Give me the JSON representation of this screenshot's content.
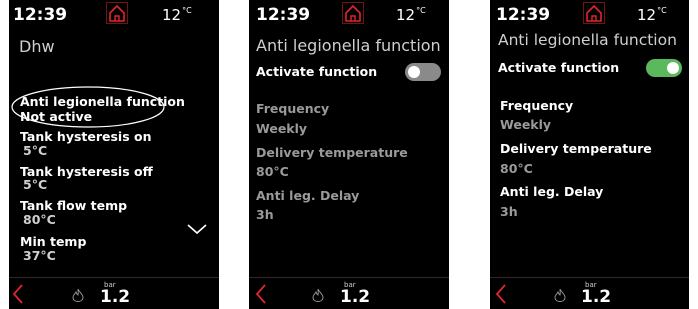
{
  "colors": {
    "accent": "#e0262c",
    "toggle_on": "#5cb85c",
    "toggle_off": "#8a8a8a"
  },
  "screens": [
    {
      "status": {
        "time": "12:39",
        "temperature": "12",
        "temperature_unit": "°C"
      },
      "title": "Dhw",
      "items": [
        {
          "label": "Anti legionella function",
          "value": "Not active"
        },
        {
          "label": "Tank hysteresis on",
          "value": "5°C"
        },
        {
          "label": "Tank hysteresis off",
          "value": "5°C"
        },
        {
          "label": "Tank flow temp",
          "value": "80°C"
        },
        {
          "label": "Min temp",
          "value": "37°C"
        }
      ],
      "footer": {
        "pressure_unit": "bar",
        "pressure": "1.2"
      }
    },
    {
      "status": {
        "time": "12:39",
        "temperature": "12",
        "temperature_unit": "°C"
      },
      "title": "Anti legionella function",
      "toggle": {
        "label": "Activate function",
        "on": false
      },
      "items": [
        {
          "label": "Frequency",
          "value": "Weekly"
        },
        {
          "label": "Delivery temperature",
          "value": "80°C"
        },
        {
          "label": "Anti leg. Delay",
          "value": "3h"
        }
      ],
      "footer": {
        "pressure_unit": "bar",
        "pressure": "1.2"
      }
    },
    {
      "status": {
        "time": "12:39",
        "temperature": "12",
        "temperature_unit": "°C"
      },
      "title": "Anti legionella function",
      "toggle": {
        "label": "Activate function",
        "on": true
      },
      "items": [
        {
          "label": "Frequency",
          "value": "Weekly"
        },
        {
          "label": "Delivery temperature",
          "value": "80°C"
        },
        {
          "label": "Anti leg. Delay",
          "value": "3h"
        }
      ],
      "footer": {
        "pressure_unit": "bar",
        "pressure": "1.2"
      }
    }
  ]
}
